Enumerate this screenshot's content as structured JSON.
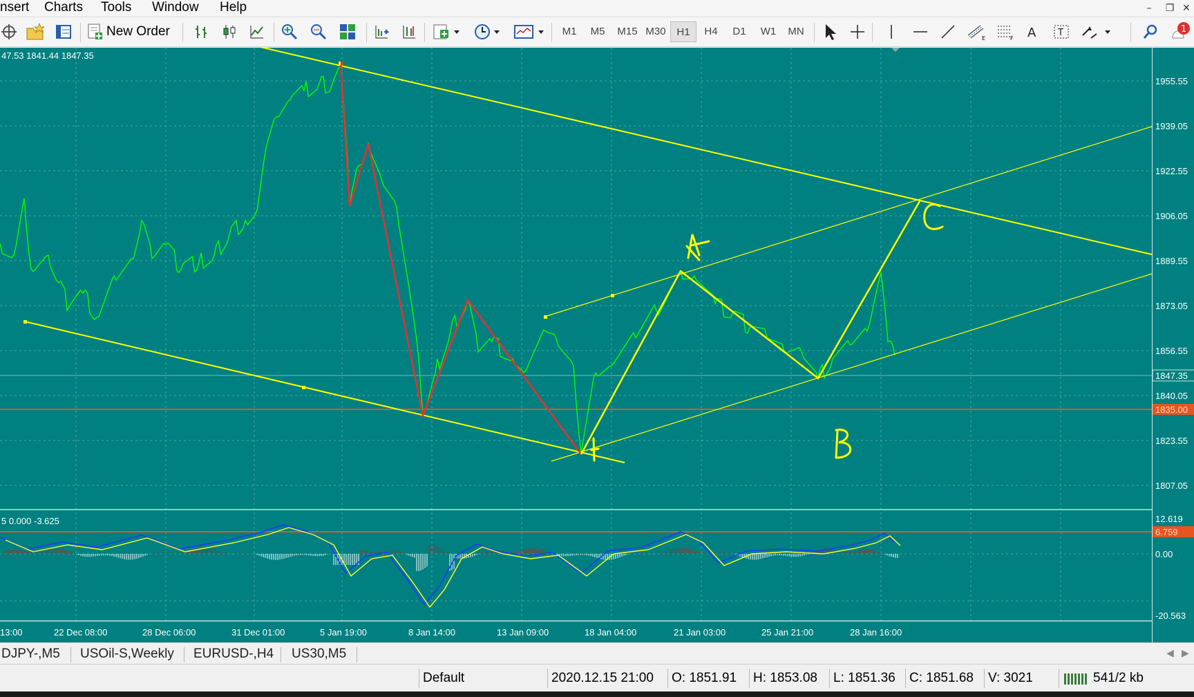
{
  "menu": [
    "nsert",
    "Charts",
    "Tools",
    "Window",
    "Help"
  ],
  "toolbar": {
    "new_order_label": "New Order",
    "timeframes": [
      "M1",
      "M5",
      "M15",
      "M30",
      "H1",
      "H4",
      "D1",
      "W1",
      "MN"
    ],
    "active_timeframe": "H1",
    "notification_count": "1"
  },
  "chart": {
    "ohlc_header": "47.53 1841.44 1847.35",
    "current_price": "1847.35",
    "level_price": "1835.00",
    "indicator_header": "5 0.000 -3.625",
    "indicator_level": "6.759",
    "wave_labels": [
      "A",
      "B",
      "C"
    ],
    "colors": {
      "background": "#008080",
      "candles": "#00ff00",
      "trendlines": "#ffff00",
      "impulse": "#e53030",
      "level": "#e8541f"
    }
  },
  "chart_data": {
    "type": "line",
    "instrument_timeframe": "H1",
    "price_axis_ticks": [
      "1955.55",
      "1939.05",
      "1922.55",
      "1906.05",
      "1889.55",
      "1873.05",
      "1856.55",
      "1840.05",
      "1823.55",
      "1807.05"
    ],
    "indicator_axis_ticks": [
      "12.619",
      "0.00",
      "-20.563"
    ],
    "time_axis_ticks": [
      "13:00",
      "22 Dec 08:00",
      "28 Dec 06:00",
      "31 Dec 01:00",
      "5 Jan 19:00",
      "8 Jan 14:00",
      "13 Jan 09:00",
      "18 Jan 04:00",
      "21 Jan 03:00",
      "25 Jan 21:00",
      "28 Jan 16:00"
    ],
    "ylim": [
      1800,
      1968
    ],
    "xlim": [
      0,
      100
    ]
  },
  "tabs": [
    "DJPY-,M5",
    "USOil-S,Weekly",
    "EURUSD-,H4",
    "US30,M5"
  ],
  "status": {
    "profile": "Default",
    "datetime": "2020.12.15 21:00",
    "open": "O: 1851.91",
    "high": "H: 1853.08",
    "low": "L: 1851.36",
    "close": "C: 1851.68",
    "volume": "V: 3021",
    "traffic": "541/2 kb"
  }
}
